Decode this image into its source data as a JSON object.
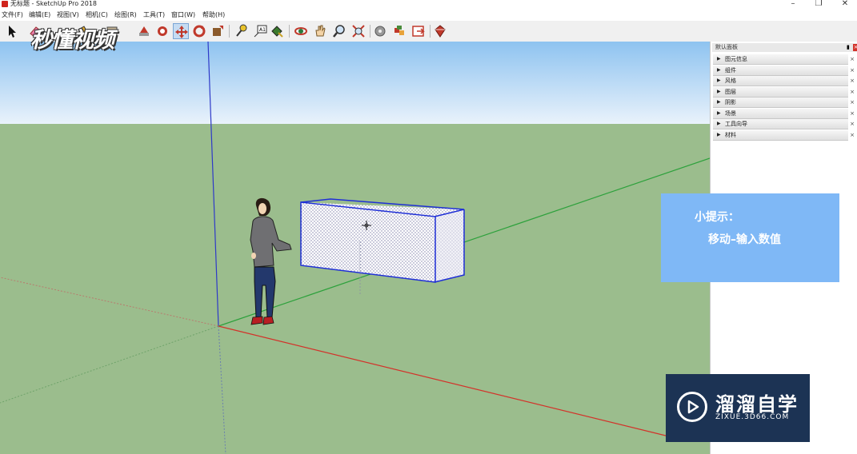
{
  "window": {
    "title": "无标题 - SketchUp Pro 2018",
    "minimize": "–",
    "restore": "❐",
    "close": "✕"
  },
  "menu": [
    "文件(F)",
    "编辑(E)",
    "视图(V)",
    "相机(C)",
    "绘图(R)",
    "工具(T)",
    "窗口(W)",
    "帮助(H)"
  ],
  "watermark": "秒懂视频",
  "toolbar": {
    "tools": [
      "select-icon",
      "eraser-icon",
      "paint-bucket-icon",
      "rectangle-icon",
      "push-pull-icon",
      "move-icon",
      "rotate-icon",
      "scale-icon",
      "tape-measure-icon",
      "text-icon",
      "paint-icon",
      "orbit-icon",
      "pan-icon",
      "zoom-icon",
      "zoom-extents-icon",
      "warehouse-icon",
      "components-icon",
      "extension-icon",
      "ruby-icon"
    ]
  },
  "panel": {
    "title": "默认面板",
    "trays": [
      "图元信息",
      "组件",
      "风格",
      "图层",
      "阴影",
      "场景",
      "工具向导",
      "材料"
    ],
    "close_glyph": "×",
    "arrow_glyph": "▶"
  },
  "tip": {
    "title": "小提示：",
    "body": "移动–输入数值"
  },
  "brand": {
    "name": "溜溜自学",
    "url": "ZIXUE.3D66.COM"
  },
  "colors": {
    "sky_top": "#8ec3f0",
    "sky_bottom": "#e9f2fb",
    "ground": "#9bbd8d",
    "tip_bg": "#7fb8f6",
    "brand_bg": "#1c3354"
  }
}
